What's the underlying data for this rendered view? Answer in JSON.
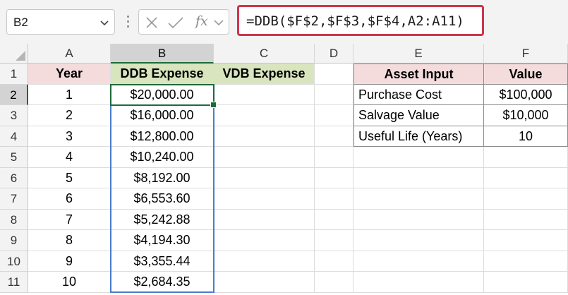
{
  "name_box": {
    "value": "B2"
  },
  "formula_bar": {
    "formula": "=DDB($F$2,$F$3,$F$4,A2:A11)",
    "fx_label": "fx",
    "cancel_icon": "close-icon",
    "enter_icon": "checkmark-icon"
  },
  "columns": [
    "A",
    "B",
    "C",
    "D",
    "E",
    "F"
  ],
  "rows": [
    "1",
    "2",
    "3",
    "4",
    "5",
    "6",
    "7",
    "8",
    "9",
    "10",
    "11"
  ],
  "selection": {
    "active_cell": "B2",
    "selected_column": "B",
    "selected_row": "2"
  },
  "depreciation_table": {
    "headers": {
      "year": "Year",
      "ddb": "DDB Expense",
      "vdb": "VDB Expense"
    },
    "years": [
      "1",
      "2",
      "3",
      "4",
      "5",
      "6",
      "7",
      "8",
      "9",
      "10"
    ],
    "ddb": [
      "$20,000.00",
      "$16,000.00",
      "$12,800.00",
      "$10,240.00",
      "$8,192.00",
      "$6,553.60",
      "$5,242.88",
      "$4,194.30",
      "$3,355.44",
      "$2,684.35"
    ]
  },
  "asset_table": {
    "headers": {
      "input": "Asset Input",
      "value": "Value"
    },
    "rows": [
      {
        "label": "Purchase Cost",
        "value": "$100,000"
      },
      {
        "label": "Salvage Value",
        "value": "$10,000"
      },
      {
        "label": "Useful Life (Years)",
        "value": "10"
      }
    ]
  },
  "colors": {
    "header_pink": "#f4dcdd",
    "header_green": "#d8e5bf",
    "selection_green": "#1d6b3b",
    "range_blue": "#4a7cc9",
    "formula_highlight": "#d1334a"
  }
}
